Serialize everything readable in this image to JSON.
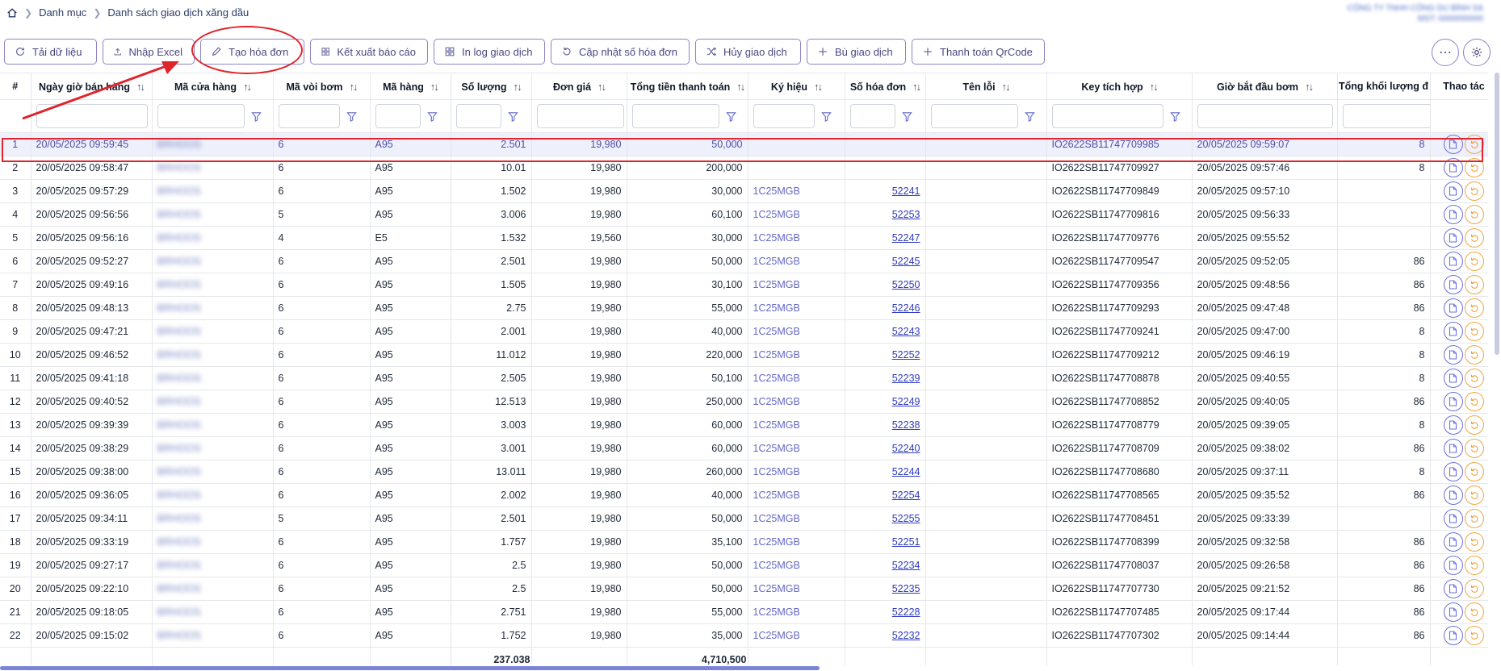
{
  "breadcrumb": {
    "items": [
      "Danh mục",
      "Danh sách giao dịch xăng dầu"
    ]
  },
  "company": {
    "line1": "CÔNG TY TNHH CÔNG DU BÌNH SA",
    "line2": "MST: 0000000000"
  },
  "toolbar": [
    {
      "label": "Tải dữ liệu",
      "icon": "refresh-icon"
    },
    {
      "label": "Nhập Excel",
      "icon": "upload-icon"
    },
    {
      "label": "Tạo hóa đơn",
      "icon": "pencil-icon"
    },
    {
      "label": "Kết xuất báo cáo",
      "icon": "grid-icon"
    },
    {
      "label": "In log giao dịch",
      "icon": "grid-icon"
    },
    {
      "label": "Cập nhật số hóa đơn",
      "icon": "rotate-icon"
    },
    {
      "label": "Hủy giao dịch",
      "icon": "shuffle-icon"
    },
    {
      "label": "Bù giao dịch",
      "icon": "plus-icon"
    },
    {
      "label": "Thanh toán QrCode",
      "icon": "plus-icon"
    }
  ],
  "columns": [
    "#",
    "Ngày giờ bán hàng",
    "Mã cửa hàng",
    "Mã vòi bơm",
    "Mã hàng",
    "Số lượng",
    "Đơn giá",
    "Tổng tiền thanh toán",
    "Ký hiệu",
    "Số hóa đơn",
    "Tên lỗi",
    "Key tích hợp",
    "Giờ bắt đầu bơm",
    "Tổng khối lượng đ",
    "Thao tác"
  ],
  "rows": [
    {
      "n": "1",
      "date": "20/05/2025 09:59:45",
      "store": "BRHOOS",
      "pump": "6",
      "item": "A95",
      "qty": "2.501",
      "price": "19,980",
      "total": "50,000",
      "sym": "",
      "inv": "",
      "key": "IO2622SB11747709985",
      "start": "20/05/2025 09:59:07",
      "vol": "8"
    },
    {
      "n": "2",
      "date": "20/05/2025 09:58:47",
      "store": "BRHOOS",
      "pump": "6",
      "item": "A95",
      "qty": "10.01",
      "price": "19,980",
      "total": "200,000",
      "sym": "",
      "inv": "",
      "key": "IO2622SB11747709927",
      "start": "20/05/2025 09:57:46",
      "vol": "8"
    },
    {
      "n": "3",
      "date": "20/05/2025 09:57:29",
      "store": "BRHOOS",
      "pump": "6",
      "item": "A95",
      "qty": "1.502",
      "price": "19,980",
      "total": "30,000",
      "sym": "1C25MGB",
      "inv": "52241",
      "key": "IO2622SB11747709849",
      "start": "20/05/2025 09:57:10",
      "vol": ""
    },
    {
      "n": "4",
      "date": "20/05/2025 09:56:56",
      "store": "BRHOOS",
      "pump": "5",
      "item": "A95",
      "qty": "3.006",
      "price": "19,980",
      "total": "60,100",
      "sym": "1C25MGB",
      "inv": "52253",
      "key": "IO2622SB11747709816",
      "start": "20/05/2025 09:56:33",
      "vol": ""
    },
    {
      "n": "5",
      "date": "20/05/2025 09:56:16",
      "store": "BRHOOS",
      "pump": "4",
      "item": "E5",
      "qty": "1.532",
      "price": "19,560",
      "total": "30,000",
      "sym": "1C25MGB",
      "inv": "52247",
      "key": "IO2622SB11747709776",
      "start": "20/05/2025 09:55:52",
      "vol": ""
    },
    {
      "n": "6",
      "date": "20/05/2025 09:52:27",
      "store": "BRHOOS",
      "pump": "6",
      "item": "A95",
      "qty": "2.501",
      "price": "19,980",
      "total": "50,000",
      "sym": "1C25MGB",
      "inv": "52245",
      "key": "IO2622SB11747709547",
      "start": "20/05/2025 09:52:05",
      "vol": "86"
    },
    {
      "n": "7",
      "date": "20/05/2025 09:49:16",
      "store": "BRHOOS",
      "pump": "6",
      "item": "A95",
      "qty": "1.505",
      "price": "19,980",
      "total": "30,100",
      "sym": "1C25MGB",
      "inv": "52250",
      "key": "IO2622SB11747709356",
      "start": "20/05/2025 09:48:56",
      "vol": "86"
    },
    {
      "n": "8",
      "date": "20/05/2025 09:48:13",
      "store": "BRHOOS",
      "pump": "6",
      "item": "A95",
      "qty": "2.75",
      "price": "19,980",
      "total": "55,000",
      "sym": "1C25MGB",
      "inv": "52246",
      "key": "IO2622SB11747709293",
      "start": "20/05/2025 09:47:48",
      "vol": "86"
    },
    {
      "n": "9",
      "date": "20/05/2025 09:47:21",
      "store": "BRHOOS",
      "pump": "6",
      "item": "A95",
      "qty": "2.001",
      "price": "19,980",
      "total": "40,000",
      "sym": "1C25MGB",
      "inv": "52243",
      "key": "IO2622SB11747709241",
      "start": "20/05/2025 09:47:00",
      "vol": "8"
    },
    {
      "n": "10",
      "date": "20/05/2025 09:46:52",
      "store": "BRHOOS",
      "pump": "6",
      "item": "A95",
      "qty": "11.012",
      "price": "19,980",
      "total": "220,000",
      "sym": "1C25MGB",
      "inv": "52252",
      "key": "IO2622SB11747709212",
      "start": "20/05/2025 09:46:19",
      "vol": "8"
    },
    {
      "n": "11",
      "date": "20/05/2025 09:41:18",
      "store": "BRHOOS",
      "pump": "6",
      "item": "A95",
      "qty": "2.505",
      "price": "19,980",
      "total": "50,100",
      "sym": "1C25MGB",
      "inv": "52239",
      "key": "IO2622SB11747708878",
      "start": "20/05/2025 09:40:55",
      "vol": "8"
    },
    {
      "n": "12",
      "date": "20/05/2025 09:40:52",
      "store": "BRHOOS",
      "pump": "6",
      "item": "A95",
      "qty": "12.513",
      "price": "19,980",
      "total": "250,000",
      "sym": "1C25MGB",
      "inv": "52249",
      "key": "IO2622SB11747708852",
      "start": "20/05/2025 09:40:05",
      "vol": "86"
    },
    {
      "n": "13",
      "date": "20/05/2025 09:39:39",
      "store": "BRHOOS",
      "pump": "6",
      "item": "A95",
      "qty": "3.003",
      "price": "19,980",
      "total": "60,000",
      "sym": "1C25MGB",
      "inv": "52238",
      "key": "IO2622SB11747708779",
      "start": "20/05/2025 09:39:05",
      "vol": "8"
    },
    {
      "n": "14",
      "date": "20/05/2025 09:38:29",
      "store": "BRHOOS",
      "pump": "6",
      "item": "A95",
      "qty": "3.001",
      "price": "19,980",
      "total": "60,000",
      "sym": "1C25MGB",
      "inv": "52240",
      "key": "IO2622SB11747708709",
      "start": "20/05/2025 09:38:02",
      "vol": "86"
    },
    {
      "n": "15",
      "date": "20/05/2025 09:38:00",
      "store": "BRHOOS",
      "pump": "6",
      "item": "A95",
      "qty": "13.011",
      "price": "19,980",
      "total": "260,000",
      "sym": "1C25MGB",
      "inv": "52244",
      "key": "IO2622SB11747708680",
      "start": "20/05/2025 09:37:11",
      "vol": "8"
    },
    {
      "n": "16",
      "date": "20/05/2025 09:36:05",
      "store": "BRHOOS",
      "pump": "6",
      "item": "A95",
      "qty": "2.002",
      "price": "19,980",
      "total": "40,000",
      "sym": "1C25MGB",
      "inv": "52254",
      "key": "IO2622SB11747708565",
      "start": "20/05/2025 09:35:52",
      "vol": "86"
    },
    {
      "n": "17",
      "date": "20/05/2025 09:34:11",
      "store": "BRHOOS",
      "pump": "5",
      "item": "A95",
      "qty": "2.501",
      "price": "19,980",
      "total": "50,000",
      "sym": "1C25MGB",
      "inv": "52255",
      "key": "IO2622SB11747708451",
      "start": "20/05/2025 09:33:39",
      "vol": ""
    },
    {
      "n": "18",
      "date": "20/05/2025 09:33:19",
      "store": "BRHOOS",
      "pump": "6",
      "item": "A95",
      "qty": "1.757",
      "price": "19,980",
      "total": "35,100",
      "sym": "1C25MGB",
      "inv": "52251",
      "key": "IO2622SB11747708399",
      "start": "20/05/2025 09:32:58",
      "vol": "86"
    },
    {
      "n": "19",
      "date": "20/05/2025 09:27:17",
      "store": "BRHOOS",
      "pump": "6",
      "item": "A95",
      "qty": "2.5",
      "price": "19,980",
      "total": "50,000",
      "sym": "1C25MGB",
      "inv": "52234",
      "key": "IO2622SB11747708037",
      "start": "20/05/2025 09:26:58",
      "vol": "86"
    },
    {
      "n": "20",
      "date": "20/05/2025 09:22:10",
      "store": "BRHOOS",
      "pump": "6",
      "item": "A95",
      "qty": "2.5",
      "price": "19,980",
      "total": "50,000",
      "sym": "1C25MGB",
      "inv": "52235",
      "key": "IO2622SB11747707730",
      "start": "20/05/2025 09:21:52",
      "vol": "86"
    },
    {
      "n": "21",
      "date": "20/05/2025 09:18:05",
      "store": "BRHOOS",
      "pump": "6",
      "item": "A95",
      "qty": "2.751",
      "price": "19,980",
      "total": "55,000",
      "sym": "1C25MGB",
      "inv": "52228",
      "key": "IO2622SB11747707485",
      "start": "20/05/2025 09:17:44",
      "vol": "86"
    },
    {
      "n": "22",
      "date": "20/05/2025 09:15:02",
      "store": "BRHOOS",
      "pump": "6",
      "item": "A95",
      "qty": "1.752",
      "price": "19,980",
      "total": "35,000",
      "sym": "1C25MGB",
      "inv": "52232",
      "key": "IO2622SB11747707302",
      "start": "20/05/2025 09:14:44",
      "vol": "86"
    }
  ],
  "totals": {
    "qty": "237.038",
    "total": "4,710,500"
  },
  "selected_row": 1,
  "colors": {
    "accent": "#8a84c8",
    "highlight": "#e0242b",
    "link": "#2f3bc0",
    "symbol": "#6468c8",
    "undo": "#f0a640"
  }
}
